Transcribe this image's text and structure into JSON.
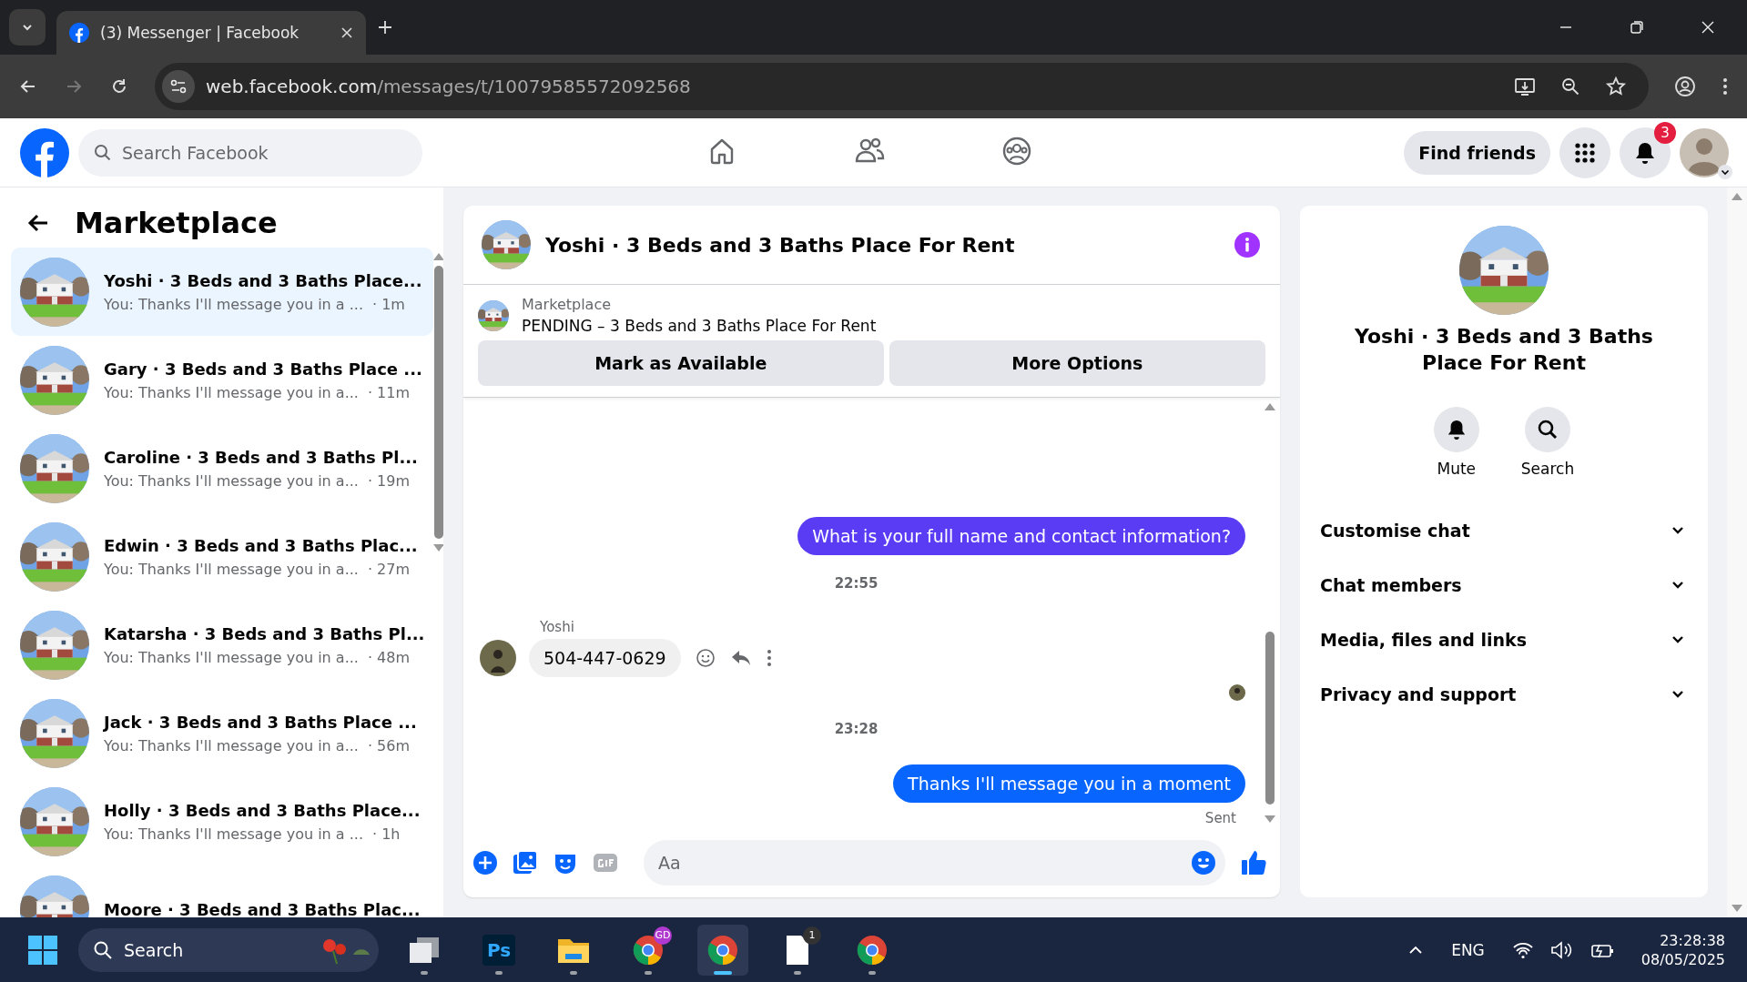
{
  "browser": {
    "tab_title": "(3) Messenger | Facebook",
    "url_host": "web.facebook.com",
    "url_path": "/messages/t/10079585572092568"
  },
  "header": {
    "search_placeholder": "Search Facebook",
    "nav": [
      {
        "kind": "home",
        "selected": false
      },
      {
        "kind": "friends",
        "selected": false
      },
      {
        "kind": "groups",
        "selected": false
      }
    ],
    "find_friends": "Find friends",
    "notification_count": "3"
  },
  "sidebar": {
    "title": "Marketplace",
    "conversations": [
      {
        "name": "Yoshi · 3 Beds and 3 Baths Place...",
        "preview": "You: Thanks I'll message you in a ...",
        "time": "· 1m",
        "selected": true
      },
      {
        "name": "Gary · 3 Beds and 3 Baths Place ...",
        "preview": "You: Thanks I'll message you in a...",
        "time": "· 11m",
        "selected": false
      },
      {
        "name": "Caroline · 3 Beds and 3 Baths Pl...",
        "preview": "You: Thanks I'll message you in a...",
        "time": "· 19m",
        "selected": false
      },
      {
        "name": "Edwin · 3 Beds and 3 Baths Plac...",
        "preview": "You: Thanks I'll message you in a...",
        "time": "· 27m",
        "selected": false
      },
      {
        "name": "Katarsha · 3 Beds and 3 Baths Pl...",
        "preview": "You: Thanks I'll message you in a...",
        "time": "· 48m",
        "selected": false
      },
      {
        "name": "Jack · 3 Beds and 3 Baths Place ...",
        "preview": "You: Thanks I'll message you in a...",
        "time": "· 56m",
        "selected": false
      },
      {
        "name": "Holly · 3 Beds and 3 Baths Place...",
        "preview": "You: Thanks I'll message you in a ...",
        "time": "· 1h",
        "selected": false
      },
      {
        "name": "Moore · 3 Beds and 3 Baths Plac...",
        "selected": false
      }
    ]
  },
  "chat": {
    "title": "Yoshi · 3 Beds and 3 Baths Place For Rent",
    "listing_source": "Marketplace",
    "listing_status": "PENDING – 3 Beds and 3 Baths Place For Rent",
    "buttons": [
      "Mark as Available",
      "More Options"
    ],
    "messages": [
      {
        "kind": "outgoing",
        "text": "What is your full name and contact information?",
        "color": "#5b3cf5"
      },
      {
        "kind": "time",
        "text": "22:55"
      },
      {
        "kind": "incoming",
        "sender": "Yoshi",
        "text": "504-447-0629"
      },
      {
        "kind": "seen"
      },
      {
        "kind": "time",
        "text": "23:28"
      },
      {
        "kind": "outgoing",
        "text": "Thanks I'll message you in a moment",
        "color": "#0866ff"
      }
    ],
    "status": "Sent",
    "composer_placeholder": "Aa"
  },
  "info": {
    "title": "Yoshi · 3 Beds and 3 Baths Place For Rent",
    "actions": [
      {
        "kind": "mute",
        "label": "Mute"
      },
      {
        "kind": "search",
        "label": "Search"
      }
    ],
    "sections": [
      {
        "label": "Customise chat",
        "expanded": false
      },
      {
        "label": "Chat members",
        "expanded": false
      },
      {
        "label": "Media, files and links",
        "expanded": false
      },
      {
        "label": "Privacy and support",
        "expanded": false
      }
    ]
  },
  "taskbar": {
    "search_placeholder": "Search",
    "apps": [
      {
        "kind": "taskview",
        "active": false
      },
      {
        "kind": "photoshop",
        "label": "Ps",
        "active": false
      },
      {
        "kind": "files",
        "active": false
      },
      {
        "kind": "chrome",
        "badge": "GD",
        "active": false
      },
      {
        "kind": "chrome",
        "active": true
      },
      {
        "kind": "notes",
        "badge": "1",
        "active": false
      },
      {
        "kind": "chrome",
        "active": false
      }
    ],
    "language": "ENG",
    "time": "23:28:38",
    "date": "08/05/2025"
  }
}
